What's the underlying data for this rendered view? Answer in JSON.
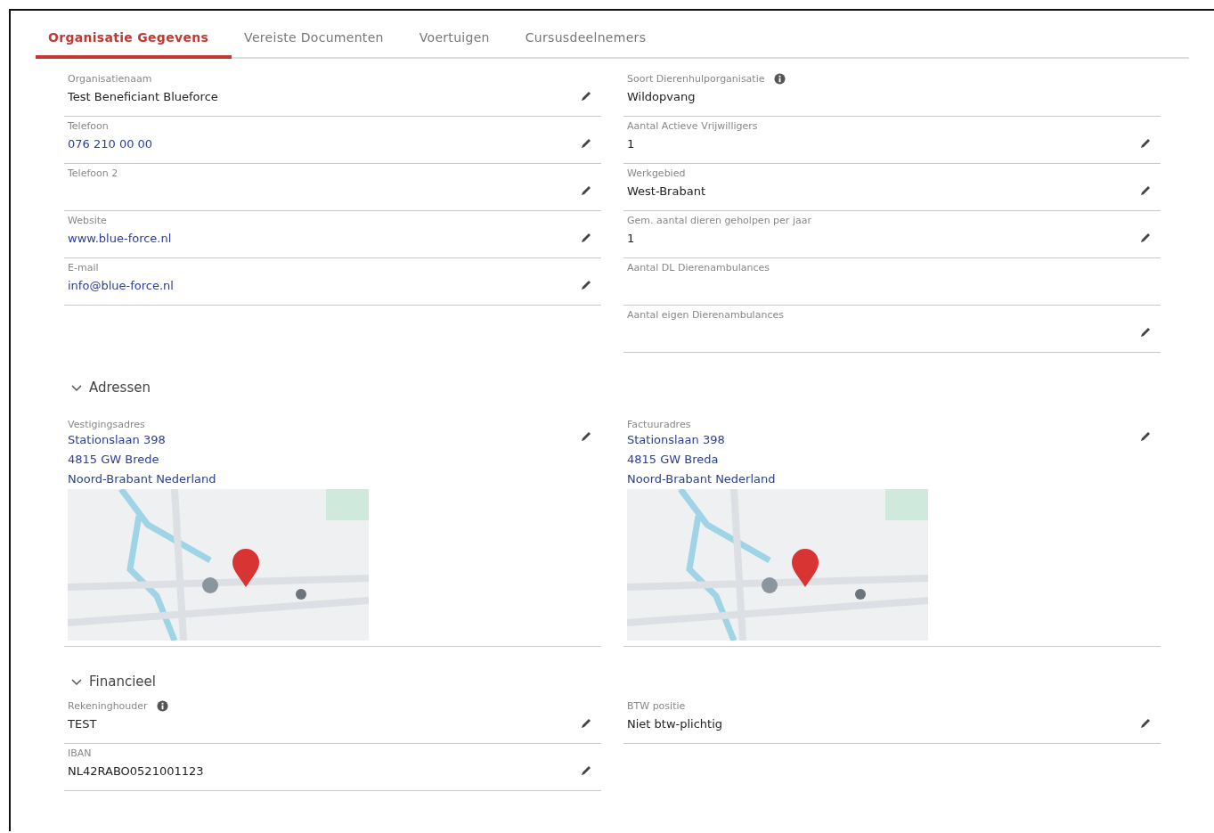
{
  "tabs": [
    {
      "label": "Organisatie Gegevens",
      "selected": true
    },
    {
      "label": "Vereiste Documenten",
      "selected": false
    },
    {
      "label": "Voertuigen",
      "selected": false
    },
    {
      "label": "Cursusdeelnemers",
      "selected": false
    }
  ],
  "details": {
    "left_fields": [
      {
        "label": "Organisatienaam",
        "value": "Test Beneficiant Blueforce",
        "kind": "text",
        "editable": true,
        "info": false
      },
      {
        "label": "Telefoon",
        "value": "076 210 00 00",
        "kind": "link",
        "editable": true,
        "info": false
      },
      {
        "label": "Telefoon 2",
        "editable": true,
        "info": false
      },
      {
        "label": "Website",
        "value": "www.blue-force.nl",
        "kind": "link",
        "editable": true,
        "info": false
      },
      {
        "label": "E-mail",
        "value": "info@blue-force.nl",
        "kind": "link",
        "editable": true,
        "info": false
      }
    ],
    "right_fields": [
      {
        "label": "Soort Dierenhulporganisatie",
        "value": "Wildopvang",
        "kind": "text",
        "editable": false,
        "info": true
      },
      {
        "label": "Aantal Actieve Vrijwilligers",
        "value": "1",
        "kind": "text",
        "editable": true,
        "info": false
      },
      {
        "label": "Werkgebied",
        "value": "West-Brabant",
        "kind": "text",
        "editable": true,
        "info": false
      },
      {
        "label": "Gem. aantal dieren geholpen per jaar",
        "value": "1",
        "kind": "text",
        "editable": true,
        "info": false
      },
      {
        "label": "Aantal DL Dierenambulances",
        "editable": false,
        "info": false
      },
      {
        "label": "Aantal eigen Dierenambulances",
        "editable": true,
        "info": false
      }
    ]
  },
  "sections": [
    {
      "title": "Adressen",
      "expanded": true,
      "kind": "addresses",
      "addresses": [
        {
          "label": "Vestigingsadres",
          "lines": [
            "Stationslaan 398",
            "4815 GW Brede",
            "Noord-Brabant Nederland"
          ],
          "editable": true
        },
        {
          "label": "Factuuradres",
          "lines": [
            "Stationslaan 398",
            "4815 GW Breda",
            "Noord-Brabant Nederland"
          ],
          "editable": true
        }
      ]
    },
    {
      "title": "Financieel",
      "expanded": true,
      "kind": "fields",
      "left_fields": [
        {
          "label": "Rekeninghouder",
          "value": "TEST",
          "kind": "text",
          "editable": true,
          "info": true
        },
        {
          "label": "IBAN",
          "value": "NL42RABO0521001123",
          "kind": "text",
          "editable": true,
          "info": false
        }
      ],
      "right_fields": [
        {
          "label": "BTW positie",
          "value": "Niet btw-plichtig",
          "kind": "text",
          "editable": true,
          "info": false
        }
      ]
    }
  ]
}
